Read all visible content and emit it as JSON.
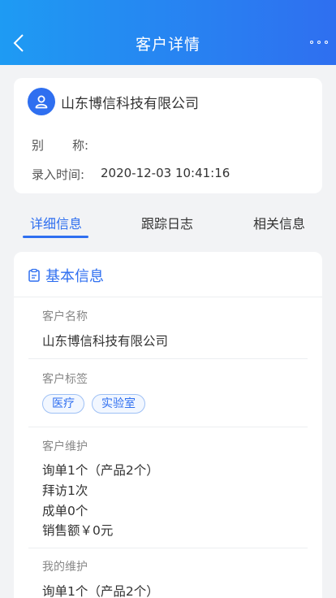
{
  "header": {
    "title": "客户详情"
  },
  "customer": {
    "name": "山东博信科技有限公司",
    "alias_label_a": "别",
    "alias_label_b": "称:",
    "entry_label": "录入时间:",
    "entry_value": "2020-12-03 10:41:16"
  },
  "tabs": [
    {
      "label": "详细信息",
      "active": true
    },
    {
      "label": "跟踪日志",
      "active": false
    },
    {
      "label": "相关信息",
      "active": false
    }
  ],
  "basic_info": {
    "title": "基本信息",
    "name_label": "客户名称",
    "name_value": "山东博信科技有限公司",
    "tags_label": "客户标签",
    "tags": [
      "医疗",
      "实验室"
    ],
    "maintenance_label": "客户维护",
    "maintenance_lines": [
      "询单1个（产品2个）",
      "拜访1次",
      "成单0个",
      "销售额￥0元"
    ],
    "my_maintenance_label": "我的维护",
    "my_maintenance_lines": [
      "询单1个（产品2个）"
    ]
  },
  "colors": {
    "accent": "#2f6ff0",
    "header_start": "#1e9bf3",
    "background": "#f2f3f5"
  },
  "icons": {
    "back": "chevron-left-icon",
    "more": "more-dots-icon",
    "avatar": "user-icon",
    "section": "clipboard-icon"
  }
}
